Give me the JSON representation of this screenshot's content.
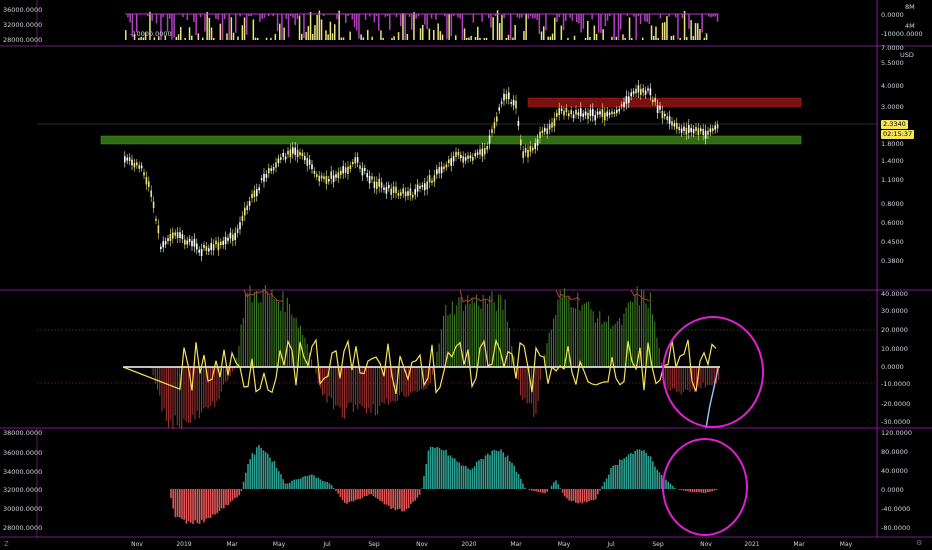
{
  "colors": {
    "background": "#000000",
    "separator": "#9c27b0",
    "bull": "#e8e37a",
    "bear": "#ffffff",
    "support_zone": "#2e6b12",
    "resistance_zone": "#7a1010",
    "osc_up": "#4a8f2a",
    "osc_down": "#b23a3a",
    "osc_line": "#f5e35a",
    "macd_up": "#2b9e8f",
    "macd_down": "#e05555",
    "annotation": "#e020d0",
    "price_tag": "#f5e35a"
  },
  "volume_pane": {
    "left_axis": [
      "36000.0000",
      "32000.0000",
      "28000.0000"
    ],
    "right_axis": [
      "0.0000",
      "8M",
      "4M",
      "-10000.0000"
    ],
    "inner_labels": [
      "-10000.0000"
    ]
  },
  "price_pane": {
    "currency": "USD",
    "top_value": "7.0000",
    "right_axis": [
      "5.5000",
      "4.0000",
      "3.0000",
      "1.8000",
      "1.4000",
      "1.1000",
      "0.8000",
      "0.6000",
      "0.4500",
      "0.3800"
    ],
    "last_price": "2.3340",
    "countdown": "02:15:37"
  },
  "oscillator_pane": {
    "right_axis": [
      "40.0000",
      "30.0000",
      "20.0000",
      "10.0000",
      "0.0000",
      "-10.0000",
      "-20.0000",
      "-30.0000"
    ]
  },
  "macd_pane": {
    "left_axis": [
      "38000.0000",
      "36000.0000",
      "34000.0000",
      "32000.0000",
      "30000.0000",
      "28000.0000"
    ],
    "right_axis": [
      "120.0000",
      "80.0000",
      "40.0000",
      "0.0000",
      "-40.0000",
      "-80.0000"
    ]
  },
  "time_axis": [
    "Nov",
    "2019",
    "Mar",
    "May",
    "Jul",
    "Sep",
    "Nov",
    "2020",
    "Mar",
    "May",
    "Jul",
    "Sep",
    "Nov",
    "2021",
    "Mar",
    "May"
  ],
  "corner_icons": {
    "left": "timezone-icon",
    "right": "settings-icon"
  },
  "corner_text": {
    "left": "Z",
    "right": "⚙"
  }
}
